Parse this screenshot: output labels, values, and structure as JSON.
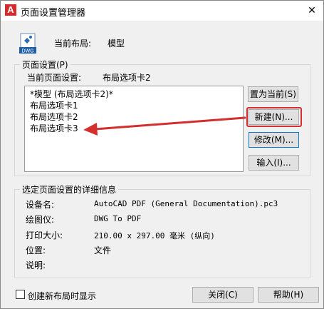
{
  "window": {
    "title": "页面设置管理器",
    "app_icon_letter": "A",
    "close_glyph": "✕"
  },
  "current_layout": {
    "icon_label": "DWG",
    "label": "当前布局:",
    "value": "模型"
  },
  "page_setups": {
    "group_title": "页面设置(P)",
    "current_label": "当前页面设置:",
    "current_value": "布局选项卡2",
    "items": [
      "*模型 (布局选项卡2)*",
      "布局选项卡1",
      "布局选项卡2",
      "布局选项卡3"
    ],
    "buttons": {
      "set_current": "置为当前(S)",
      "new": "新建(N)...",
      "modify": "修改(M)...",
      "import": "输入(I)..."
    }
  },
  "details": {
    "group_title": "选定页面设置的详细信息",
    "rows": [
      {
        "label": "设备名:",
        "value": "AutoCAD PDF (General Documentation).pc3"
      },
      {
        "label": "绘图仪:",
        "value": "DWG To PDF"
      },
      {
        "label": "打印大小:",
        "value": "210.00 x 297.00 毫米 (纵向)"
      },
      {
        "label": "位置:",
        "value": "文件"
      },
      {
        "label": "说明:",
        "value": ""
      }
    ]
  },
  "footer": {
    "show_on_create_label": "创建新布局时显示",
    "close_button": "关闭(C)",
    "help_button": "帮助(H)"
  },
  "colors": {
    "accent": "#0078d7",
    "annotation": "#d32f2f",
    "app_icon": "#d72b2b"
  }
}
